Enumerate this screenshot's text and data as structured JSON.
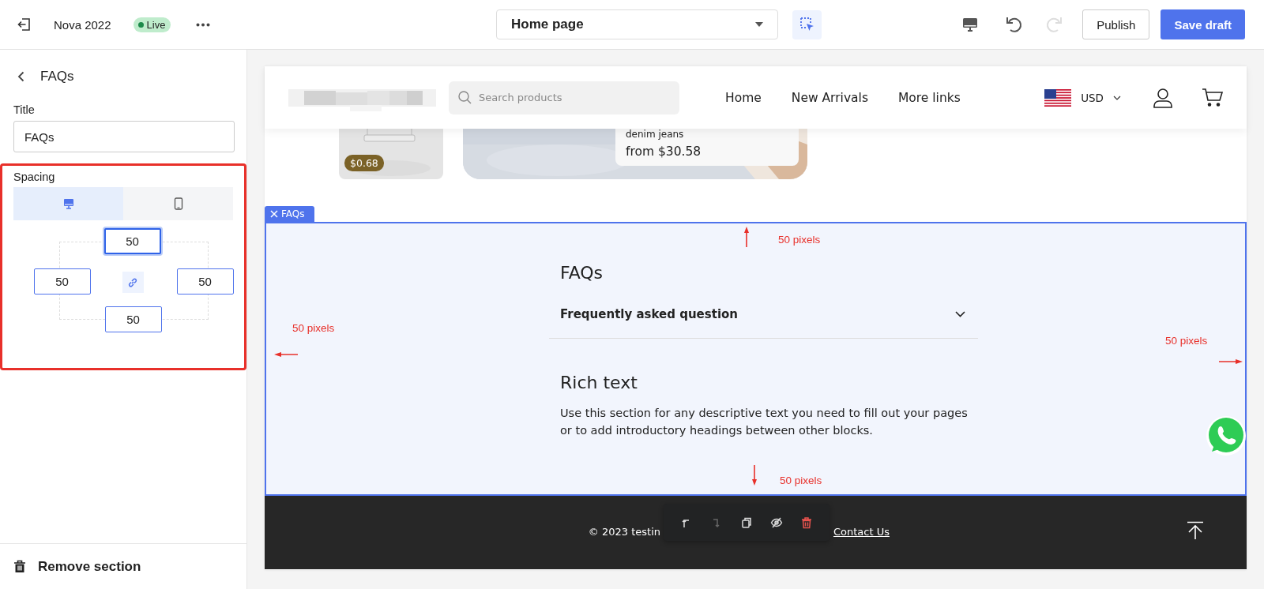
{
  "topbar": {
    "store_name": "Nova 2022",
    "status": "Live",
    "page_select": "Home page",
    "undo_disabled": false,
    "redo_disabled": true,
    "publish": "Publish",
    "save_draft": "Save draft"
  },
  "sidebar": {
    "heading": "FAQs",
    "title_label": "Title",
    "title_value": "FAQs",
    "spacing_label": "Spacing",
    "devices": [
      {
        "kind": "desktop",
        "selected": true
      },
      {
        "kind": "mobile",
        "selected": false
      }
    ],
    "spacing": [
      {
        "kind": "top",
        "value": "50",
        "focused": true
      },
      {
        "kind": "left",
        "value": "50",
        "focused": false
      },
      {
        "kind": "right",
        "value": "50",
        "focused": false
      },
      {
        "kind": "bottom",
        "value": "50",
        "focused": false
      }
    ],
    "remove": "Remove section"
  },
  "preview": {
    "search_placeholder": "Search products",
    "nav": [
      "Home",
      "New Arrivals",
      "More links"
    ],
    "currency": "USD",
    "price_badge": "$0.68",
    "card_name": "denim jeans",
    "card_price": "from $30.58",
    "section_tag": "FAQs",
    "annotations": [
      {
        "kind": "top",
        "text": "50 pixels"
      },
      {
        "kind": "left",
        "text": "50 pixels"
      },
      {
        "kind": "right",
        "text": "50 pixels"
      },
      {
        "kind": "bottom",
        "text": "50 pixels"
      }
    ],
    "faq_title": "FAQs",
    "question": "Frequently asked question",
    "rich_title": "Rich text",
    "rich_text": "Use this section for any descriptive text you need to fill out your pages or to add introductory headings between other blocks.",
    "toolbar": [
      {
        "kind": "move-up",
        "disabled": false
      },
      {
        "kind": "move-down",
        "disabled": true
      },
      {
        "kind": "duplicate",
        "disabled": false
      },
      {
        "kind": "hide",
        "disabled": false
      },
      {
        "kind": "delete",
        "disabled": false
      }
    ],
    "footer_text": "© 2023 testin",
    "footer_link": "Contact Us"
  }
}
